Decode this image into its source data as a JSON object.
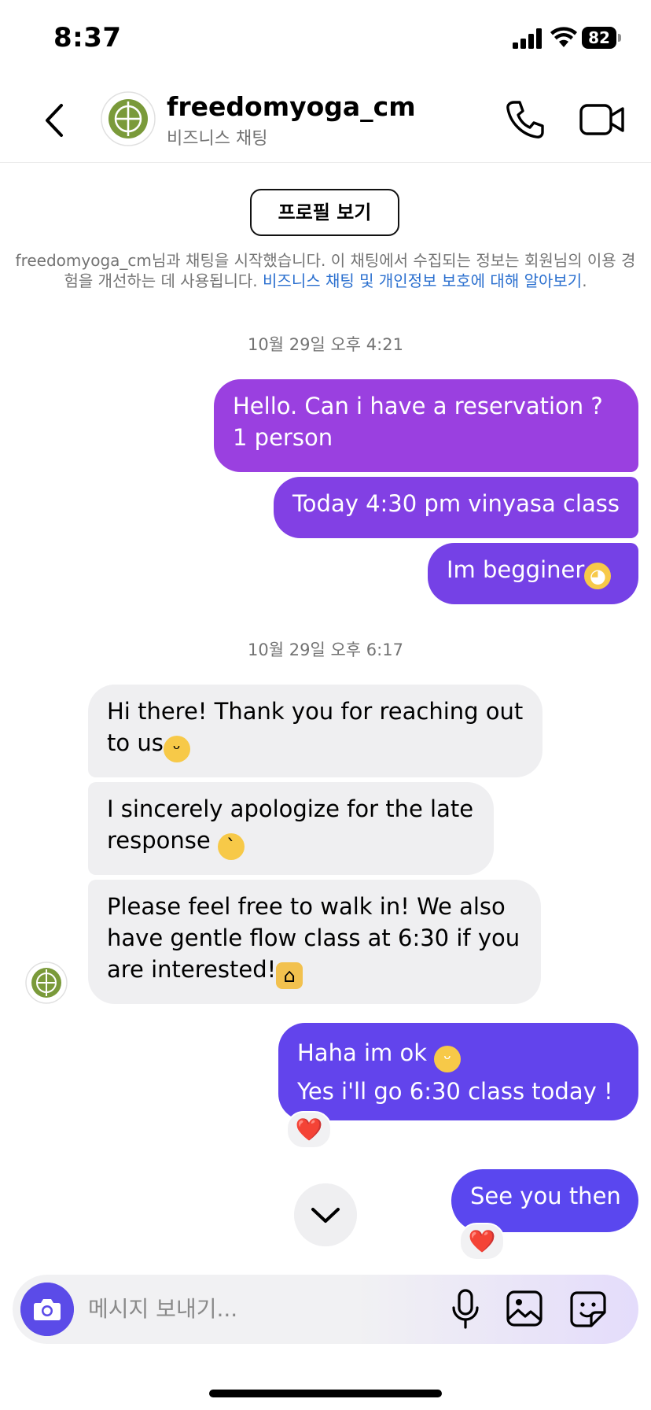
{
  "status_bar": {
    "time": "8:37",
    "battery": "82"
  },
  "header": {
    "title": "freedomyoga_cm",
    "subtitle": "비즈니스 채팅"
  },
  "profile_button": "프로필 보기",
  "info": {
    "text_1": "freedomyoga_cm님과 채팅을 시작했습니다. 이 채팅에서 수집되는 정보는 회원님의 이용 경험을 개선하는 데 사용됩니다. ",
    "link": "비즈니스 채팅 및 개인정보 보호에 대해 알아보기",
    "text_2": "."
  },
  "timestamps": [
    "10월 29일 오후 4:21",
    "10월 29일 오후 6:17"
  ],
  "messages": [
    {
      "dir": "out",
      "text": "Hello. Can i have a reservation ? 1 person"
    },
    {
      "dir": "out",
      "text": "Today 4:30 pm vinyasa class"
    },
    {
      "dir": "out",
      "text": "Im begginer",
      "emoji": "pleading-face"
    },
    {
      "dir": "in",
      "text": "Hi there! Thank you for reaching out to us",
      "emoji": "grinning-face"
    },
    {
      "dir": "in",
      "text": "I sincerely apologize for the late response ",
      "emoji": "crying-face"
    },
    {
      "dir": "in",
      "text": "Please feel free to walk in! We also have gentle flow class at 6:30 if you are interested!",
      "emoji": "folded-hands"
    },
    {
      "dir": "out",
      "line1": "Haha im ok ",
      "line1_emoji": "grinning-face",
      "line2": "Yes i'll go 6:30 class today  !",
      "reaction": "❤️"
    },
    {
      "dir": "out",
      "text": "See you then",
      "reaction": "❤️"
    }
  ],
  "composer": {
    "placeholder": "메시지 보내기..."
  },
  "colors": {
    "out_gradient_top": "#9b3fe0",
    "out_gradient_mid": "#7b3fe6",
    "out_gradient_bottom": "#5f45ee",
    "incoming_bg": "#efeff1",
    "link": "#2a6fcf",
    "avatar_green": "#7a9a3a"
  }
}
